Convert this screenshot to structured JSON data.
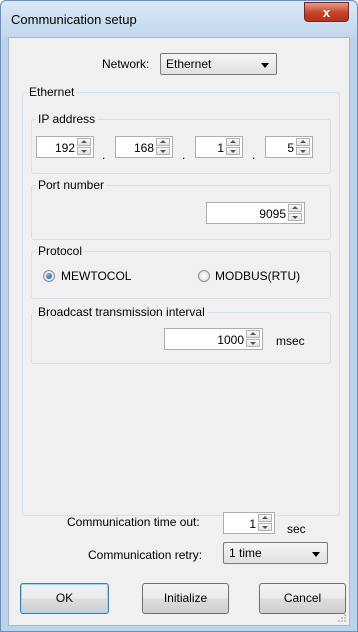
{
  "window": {
    "title": "Communication setup",
    "close_glyph": "x"
  },
  "network": {
    "label": "Network:",
    "value": "Ethernet"
  },
  "ethernet": {
    "group_label": "Ethernet",
    "ip": {
      "label": "IP address",
      "octets": [
        "192",
        "168",
        "1",
        "5"
      ],
      "separator": "."
    },
    "port": {
      "label": "Port number",
      "value": "9095"
    },
    "protocol": {
      "label": "Protocol",
      "options": [
        "MEWTOCOL",
        "MODBUS(RTU)"
      ],
      "selected": "MEWTOCOL"
    },
    "broadcast": {
      "label": "Broadcast transmission interval",
      "value": "1000",
      "unit": "msec"
    }
  },
  "timeout": {
    "label": "Communication time out:",
    "value": "1",
    "unit": "sec"
  },
  "retry": {
    "label": "Communication retry:",
    "value": "1 time"
  },
  "buttons": {
    "ok": "OK",
    "initialize": "Initialize",
    "cancel": "Cancel"
  },
  "colors": {
    "accent": "#1c4f9c",
    "close": "#c7422a"
  }
}
